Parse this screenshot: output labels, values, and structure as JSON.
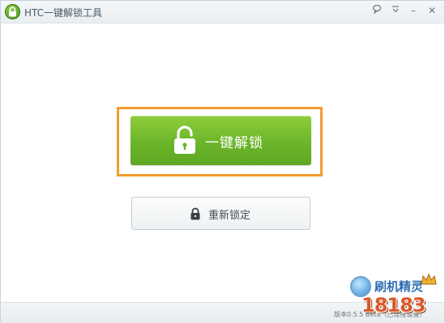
{
  "window": {
    "title": "HTC一键解锁工具"
  },
  "titlebar": {
    "feedback_icon": "speech-bubble-icon",
    "menu_icon": "menu-icon",
    "min_glyph": "–",
    "close_glyph": "✕"
  },
  "main": {
    "unlock_button_label": "一键解锁",
    "relock_button_label": "重新锁定"
  },
  "status": {
    "version_text": "版本0.5.5 Beta（已连接设备）"
  },
  "watermark": {
    "site_text": "刷机精灵",
    "logo_text": "18183"
  },
  "colors": {
    "unlock_green": "#6bb52a",
    "highlight_orange": "#f39b2e"
  }
}
